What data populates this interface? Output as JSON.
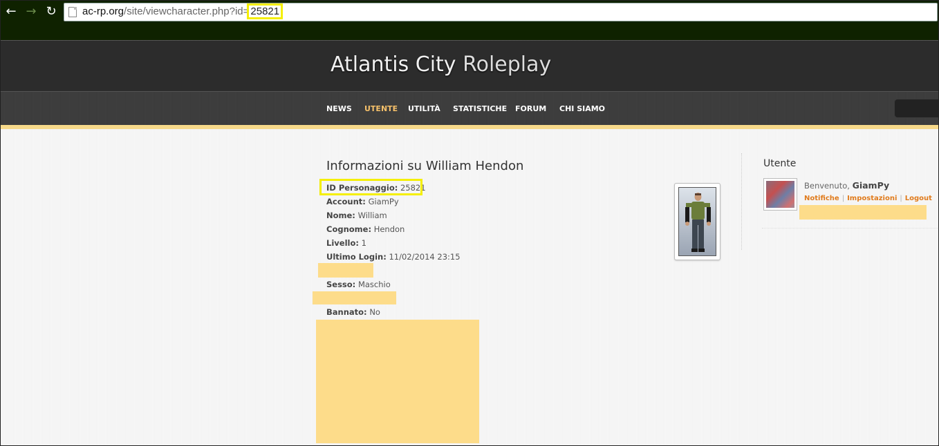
{
  "browser": {
    "back_icon": "back-arrow-icon",
    "forward_icon": "forward-arrow-icon",
    "reload_icon": "reload-icon",
    "url_host": "ac-rp.org",
    "url_path": "/site/viewcharacter.php?id=",
    "url_id": "25821"
  },
  "site": {
    "title_part1": "Atlantis City ",
    "title_part2": "Roleplay",
    "nav": {
      "news": "NEWS",
      "utente": "UTENTE",
      "utilita": "UTILITÀ",
      "statistiche": "STATISTICHE",
      "forum": "FORUM",
      "chi_siamo": "CHI SIAMO"
    },
    "accent_color": "#f7d98a"
  },
  "character": {
    "title": "Informazioni su William Hendon",
    "fields": [
      {
        "label": "ID Personaggio:",
        "value": "25821"
      },
      {
        "label": "Account:",
        "value": "GiamPy"
      },
      {
        "label": "Nome:",
        "value": "William"
      },
      {
        "label": "Cognome:",
        "value": "Hendon"
      },
      {
        "label": "Livello:",
        "value": "1"
      },
      {
        "label": "Ultimo Login:",
        "value": "11/02/2014 23:15"
      },
      {
        "label": "Sesso:",
        "value": "Maschio"
      },
      {
        "label": "Bannato:",
        "value": "No"
      }
    ]
  },
  "sidebar": {
    "title": "Utente",
    "welcome": "Benvenuto, ",
    "username": "GiamPy",
    "links": {
      "notifiche": "Notifiche",
      "impostazioni": "Impostazioni",
      "logout": "Logout"
    }
  }
}
